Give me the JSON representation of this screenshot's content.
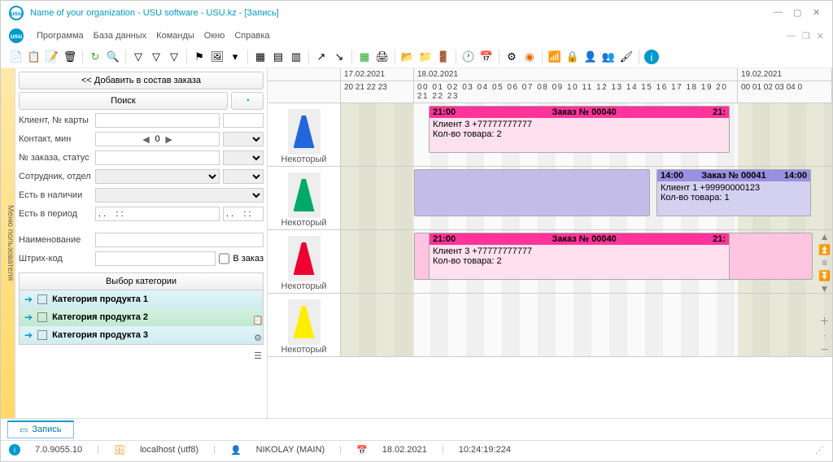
{
  "title": "Name of your organization - USU software - USU.kz - [Запись]",
  "menu": [
    "Программа",
    "База данных",
    "Команды",
    "Окно",
    "Справка"
  ],
  "sidebar_tab": "Меню пользователя",
  "left": {
    "add_btn": "<< Добавить в состав заказа",
    "search_btn": "Поиск",
    "fields": {
      "client": "Клиент, № карты",
      "contact": "Контакт, мин",
      "contact_val": "0",
      "order": "№ заказа, статус",
      "employee": "Сотрудник, отдел",
      "instock": "Есть в наличии",
      "period": "Есть в период",
      "period_val": ". .    : :",
      "name": "Наименование",
      "barcode": "Штрих-код",
      "inorder": "В заказ"
    },
    "cat_header": "Выбор категории",
    "categories": [
      "Категория продукта 1",
      "Категория продукта 2",
      "Категория продукта 3"
    ]
  },
  "gantt": {
    "dates": [
      "17.02.2021",
      "18.02.2021",
      "19.02.2021"
    ],
    "hours1": "20 21 22 23",
    "hours2": "00 01 02 03 04 05 06 07 08 09 10 11 12 13 14 15 16 17 18 19 20 21 22 23",
    "hours3": "00 01 02 03 04 0",
    "rowlabel": "Некоторый",
    "orders": [
      {
        "start": "21:00",
        "end": "21:",
        "title": "Заказ № 00040",
        "client": "Клиент 3 +77777777777",
        "qty": "Кол-во товара: 2"
      },
      {
        "start": "14:00",
        "end": "14:00",
        "title": "Заказ № 00041",
        "client": "Клиент 1 +99990000123",
        "qty": "Кол-во товара: 1"
      },
      {
        "start": "21:00",
        "end": "21:",
        "title": "Заказ № 00040",
        "client": "Клиент 3 +77777777777",
        "qty": "Кол-во товара: 2"
      }
    ]
  },
  "tab": "Запись",
  "status": {
    "ver": "7.0.9055.10",
    "db": "localhost (utf8)",
    "user": "NIKOLAY (MAIN)",
    "date": "18.02.2021",
    "time": "10:24:19:224"
  }
}
